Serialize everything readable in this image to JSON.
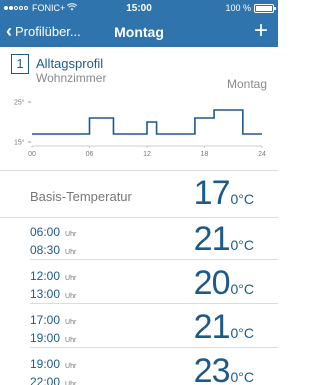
{
  "status_bar": {
    "carrier": "FONIC+",
    "wifi_icon": "wifi-icon",
    "time": "15:00",
    "battery": "100 %",
    "battery_level": 1.0,
    "signal_bars_filled": 2
  },
  "nav": {
    "back_label": "Profilüber...",
    "title": "Montag",
    "add_label": "+"
  },
  "profile": {
    "number": "1",
    "name": "Alltagsprofil",
    "room": "Wohnzimmer",
    "day": "Montag"
  },
  "chart_data": {
    "type": "line",
    "step": true,
    "y_tick_labels": [
      "25°",
      "15°"
    ],
    "y_ticks": [
      25,
      15
    ],
    "x_ticks": [
      "00",
      "06",
      "12",
      "18",
      "24"
    ],
    "x_range": [
      0,
      24
    ],
    "y_range": [
      15,
      25
    ],
    "color": "#1d5a8a",
    "points": [
      {
        "x": 0,
        "y": 17
      },
      {
        "x": 6,
        "y": 17
      },
      {
        "x": 6,
        "y": 21
      },
      {
        "x": 8.5,
        "y": 21
      },
      {
        "x": 8.5,
        "y": 17
      },
      {
        "x": 12,
        "y": 17
      },
      {
        "x": 12,
        "y": 20
      },
      {
        "x": 13,
        "y": 20
      },
      {
        "x": 13,
        "y": 17
      },
      {
        "x": 17,
        "y": 17
      },
      {
        "x": 17,
        "y": 21
      },
      {
        "x": 19,
        "y": 21
      },
      {
        "x": 19,
        "y": 23
      },
      {
        "x": 22,
        "y": 23
      },
      {
        "x": 22,
        "y": 17
      },
      {
        "x": 24,
        "y": 17
      }
    ]
  },
  "base": {
    "label": "Basis-Temperatur",
    "value": "17",
    "unit": "0°C"
  },
  "uhr_label": "Uhr",
  "periods": [
    {
      "start": "06:00",
      "end": "08:30",
      "value": "21",
      "unit": "0°C"
    },
    {
      "start": "12:00",
      "end": "13:00",
      "value": "20",
      "unit": "0°C"
    },
    {
      "start": "17:00",
      "end": "19:00",
      "value": "21",
      "unit": "0°C"
    },
    {
      "start": "19:00",
      "end": "22:00",
      "value": "23",
      "unit": "0°C"
    }
  ]
}
